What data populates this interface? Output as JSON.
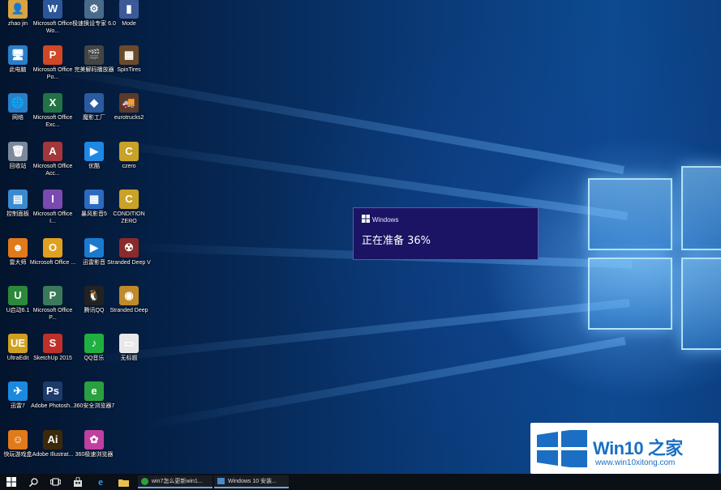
{
  "desktop": {
    "icons": [
      {
        "label": "zhao jin",
        "glyph": "👤",
        "color": "#d9a441"
      },
      {
        "label": "Microsoft Office Wo...",
        "glyph": "W",
        "color": "#2b579a"
      },
      {
        "label": "极速换设专家 6.0",
        "glyph": "⚙",
        "color": "#4a6a8a"
      },
      {
        "label": "Mode",
        "glyph": "▮",
        "color": "#3c5a9a"
      },
      {
        "label": "此电脑",
        "glyph": "🖥",
        "color": "#2a7ec9"
      },
      {
        "label": "Microsoft Office Po...",
        "glyph": "P",
        "color": "#d24726"
      },
      {
        "label": "完美解码播放器",
        "glyph": "🎬",
        "color": "#444"
      },
      {
        "label": "SpinTires",
        "glyph": "▦",
        "color": "#6b4a2a"
      },
      {
        "label": "网络",
        "glyph": "🌐",
        "color": "#2a7ec9"
      },
      {
        "label": "Microsoft Office Exc...",
        "glyph": "X",
        "color": "#217346"
      },
      {
        "label": "魔影工厂",
        "glyph": "◆",
        "color": "#2a5aa0"
      },
      {
        "label": "eurotrucks2",
        "glyph": "🚚",
        "color": "#5a3a2a"
      },
      {
        "label": "回收站",
        "glyph": "🗑",
        "color": "#7a8a9a"
      },
      {
        "label": "Microsoft Office Acc...",
        "glyph": "A",
        "color": "#a4373a"
      },
      {
        "label": "优酷",
        "glyph": "▶",
        "color": "#1e88e5"
      },
      {
        "label": "czero",
        "glyph": "C",
        "color": "#c9a227"
      },
      {
        "label": "控制面板",
        "glyph": "▤",
        "color": "#3a8ad0"
      },
      {
        "label": "Microsoft Office I...",
        "glyph": "I",
        "color": "#7a4ab0"
      },
      {
        "label": "暴风影音5",
        "glyph": "▦",
        "color": "#2a6ac0"
      },
      {
        "label": "CONDITION ZERO",
        "glyph": "C",
        "color": "#c9a227"
      },
      {
        "label": "雷大师",
        "glyph": "☻",
        "color": "#e07a1a"
      },
      {
        "label": "Microsoft Office ...",
        "glyph": "O",
        "color": "#e0a020"
      },
      {
        "label": "迅雷影音",
        "glyph": "▶",
        "color": "#1a7ad0"
      },
      {
        "label": "Stranded Deep V",
        "glyph": "☢",
        "color": "#8a2a2a"
      },
      {
        "label": "U启动6.1",
        "glyph": "U",
        "color": "#2a8a3a"
      },
      {
        "label": "Microsoft Office P...",
        "glyph": "P",
        "color": "#3a7a5a"
      },
      {
        "label": "腾讯QQ",
        "glyph": "🐧",
        "color": "#222"
      },
      {
        "label": "Stranded Deep",
        "glyph": "◉",
        "color": "#c08a2a"
      },
      {
        "label": "UltraEdit",
        "glyph": "UE",
        "color": "#d0a020"
      },
      {
        "label": "SketchUp 2015",
        "glyph": "S",
        "color": "#c0302a"
      },
      {
        "label": "QQ音乐",
        "glyph": "♪",
        "color": "#20b040"
      },
      {
        "label": "无标题",
        "glyph": "▭",
        "color": "#e8e8e8"
      },
      {
        "label": "迅雷7",
        "glyph": "✈",
        "color": "#1a8ae0"
      },
      {
        "label": "Adobe Photosh...",
        "glyph": "Ps",
        "color": "#1c3a6a"
      },
      {
        "label": "360安全浏览器7",
        "glyph": "e",
        "color": "#2aa040"
      },
      {
        "label": "",
        "glyph": "",
        "color": ""
      },
      {
        "label": "快玩游戏盒",
        "glyph": "☺",
        "color": "#e07a1a"
      },
      {
        "label": "Adobe Illustrat...",
        "glyph": "Ai",
        "color": "#3a2a0a"
      },
      {
        "label": "360极速浏览器",
        "glyph": "✿",
        "color": "#c040a0"
      },
      {
        "label": "",
        "glyph": "",
        "color": ""
      }
    ]
  },
  "toast": {
    "app_name": "Windows",
    "message": "正在准备 36%",
    "progress_percent": 36
  },
  "taskbar": {
    "start_icon": "windows-logo-icon",
    "apps": [
      {
        "label": "win7怎么更新win1...",
        "icon": "browser-icon"
      },
      {
        "label": "Windows 10 安装...",
        "icon": "installer-icon"
      }
    ]
  },
  "watermark": {
    "title": "Win10 之家",
    "url": "www.win10xitong.com",
    "accent": "#1a6fc4"
  }
}
